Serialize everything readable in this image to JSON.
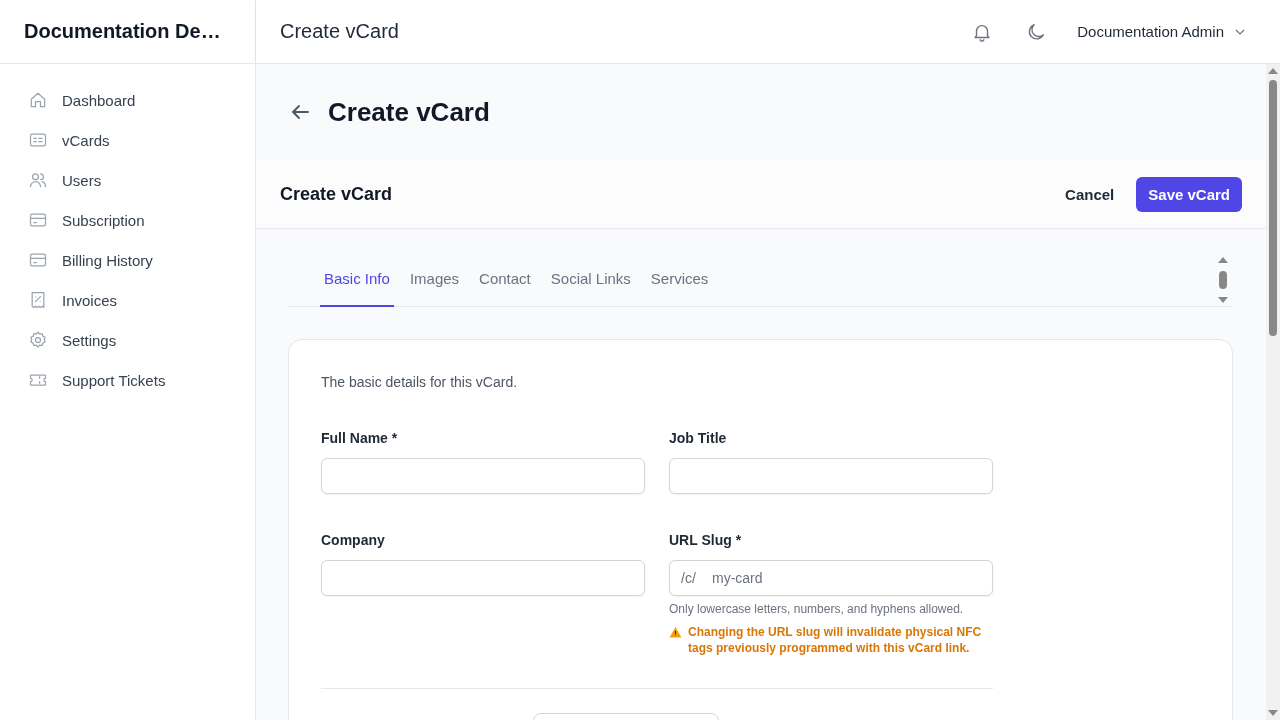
{
  "sidebar": {
    "brand": "Documentation De…",
    "items": [
      {
        "label": "Dashboard",
        "selected": false
      },
      {
        "label": "vCards",
        "selected": false
      },
      {
        "label": "Users",
        "selected": false
      },
      {
        "label": "Subscription",
        "selected": false
      },
      {
        "label": "Billing History",
        "selected": false
      },
      {
        "label": "Invoices",
        "selected": false
      },
      {
        "label": "Settings",
        "selected": false
      },
      {
        "label": "Support Tickets",
        "selected": false
      }
    ]
  },
  "header": {
    "title": "Create vCard",
    "user": "Documentation Admin"
  },
  "page": {
    "title": "Create vCard"
  },
  "form_header": {
    "title": "Create vCard",
    "buttons": [
      {
        "label": "Cancel",
        "kind": "plain"
      },
      {
        "label": "Save vCard",
        "kind": "primary"
      }
    ]
  },
  "tabs": [
    {
      "label": "Basic Info",
      "selected": true
    },
    {
      "label": "Images",
      "selected": false
    },
    {
      "label": "Contact",
      "selected": false
    },
    {
      "label": "Social Links",
      "selected": false
    },
    {
      "label": "Services",
      "selected": false
    }
  ],
  "section": {
    "description": "The basic details for this vCard.",
    "fields": [
      {
        "label": "Full Name *"
      },
      {
        "label": "Job Title"
      },
      {
        "label": "Company"
      },
      {
        "label": "URL Slug *",
        "prefix": "/c/",
        "placeholder": "my-card",
        "hint": "Only lowercase letters, numbers, and hyphens allowed.",
        "warning": "Changing the URL slug will invalidate physical NFC tags previously programmed with this vCard link."
      }
    ]
  }
}
